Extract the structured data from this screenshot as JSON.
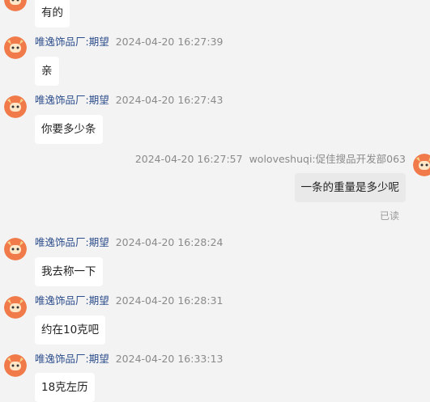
{
  "messages": [
    {
      "text": "有的"
    },
    {
      "sender": "唯逸饰品厂:期望",
      "time": "2024-04-20 16:27:39",
      "text": "亲"
    },
    {
      "sender": "唯逸饰品厂:期望",
      "time": "2024-04-20 16:27:43",
      "text": "你要多少条"
    },
    {
      "sender": "woloveshuqi:促佳搜品开发部063",
      "time": "2024-04-20 16:27:57",
      "text": "一条的重量是多少呢",
      "status": "已读"
    },
    {
      "sender": "唯逸饰品厂:期望",
      "time": "2024-04-20 16:28:24",
      "text": "我去称一下"
    },
    {
      "sender": "唯逸饰品厂:期望",
      "time": "2024-04-20 16:28:31",
      "text": "约在10克吧"
    },
    {
      "sender": "唯逸饰品厂:期望",
      "time": "2024-04-20 16:33:13",
      "text": "18克左历"
    }
  ]
}
